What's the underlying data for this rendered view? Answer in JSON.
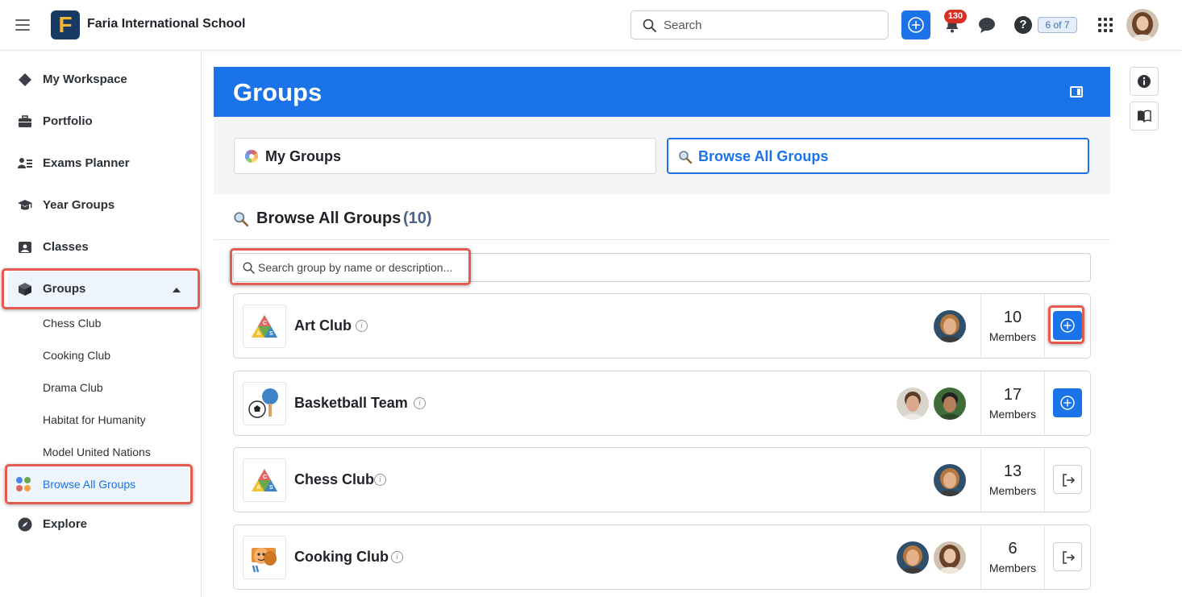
{
  "header": {
    "school_name": "Faria International School",
    "logo_letter": "F",
    "search_placeholder": "Search",
    "notification_count": "130",
    "help_label": "?",
    "pager_label": "6 of 7"
  },
  "sidebar": {
    "items": [
      {
        "label": "My Workspace",
        "icon": "workspace-icon"
      },
      {
        "label": "Portfolio",
        "icon": "briefcase-icon"
      },
      {
        "label": "Exams Planner",
        "icon": "planner-icon"
      },
      {
        "label": "Year Groups",
        "icon": "graduation-cap-icon"
      },
      {
        "label": "Classes",
        "icon": "classes-icon"
      },
      {
        "label": "Groups",
        "icon": "cube-icon"
      },
      {
        "label": "Explore",
        "icon": "compass-icon"
      }
    ],
    "group_children": [
      "Chess Club",
      "Cooking Club",
      "Drama Club",
      "Habitat for Humanity",
      "Model United Nations"
    ],
    "browse_label": "Browse All Groups"
  },
  "main": {
    "title": "Groups",
    "tabs": [
      {
        "label": "My Groups",
        "icon": "color-wheel-icon",
        "selected": false
      },
      {
        "label": "Browse All Groups",
        "icon": "magnifier-icon",
        "selected": true
      }
    ],
    "section_title": "Browse All Groups",
    "section_count": "(10)",
    "group_search_placeholder": "Search group by name or description...",
    "members_label": "Members",
    "groups": [
      {
        "name": "Art Club",
        "members": "10",
        "action": "join",
        "icon": "cas-triangle-icon"
      },
      {
        "name": "Basketball Team",
        "members": "17",
        "action": "join",
        "icon": "sports-balls-icon"
      },
      {
        "name": "Chess Club",
        "members": "13",
        "action": "leave",
        "icon": "cas-triangle-icon"
      },
      {
        "name": "Cooking Club",
        "members": "6",
        "action": "leave",
        "icon": "theater-masks-icon"
      }
    ]
  },
  "colors": {
    "primary": "#1a73e8",
    "highlight": "#e55a4e",
    "badge": "#d93025"
  }
}
